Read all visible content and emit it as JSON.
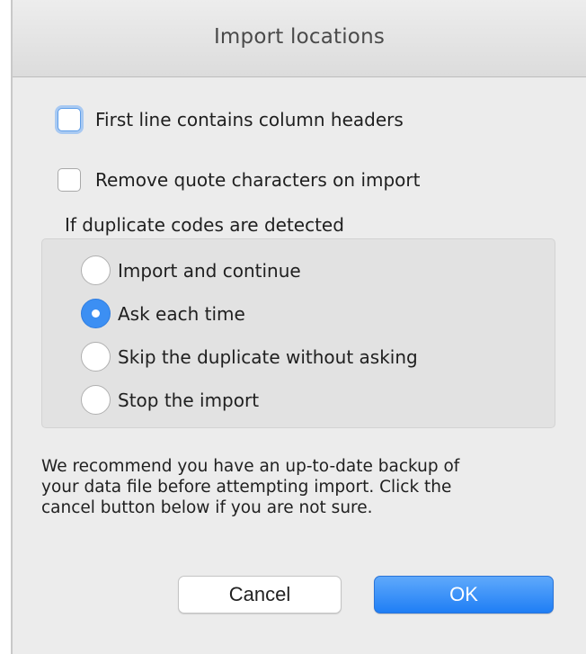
{
  "window": {
    "title": "Import locations"
  },
  "options": {
    "first_line_headers": {
      "label": "First line contains column headers",
      "checked": false
    },
    "remove_quotes": {
      "label": "Remove quote characters on import",
      "checked": false
    }
  },
  "duplicates": {
    "group_label": "If duplicate codes are detected",
    "choices": [
      {
        "label": "Import and continue",
        "selected": false
      },
      {
        "label": "Ask each time",
        "selected": true
      },
      {
        "label": "Skip the duplicate without asking",
        "selected": false
      },
      {
        "label": "Stop the import",
        "selected": false
      }
    ]
  },
  "message": {
    "line1": "We recommend you have an up-to-date backup of",
    "line2": "your data file before attempting import. Click the",
    "line3": "cancel button below if you are not sure."
  },
  "buttons": {
    "cancel_label": "Cancel",
    "ok_label": "OK"
  },
  "colors": {
    "accent": "#3c8ff3",
    "dialog_bg": "#ececec",
    "group_bg": "#e2e2e2"
  }
}
